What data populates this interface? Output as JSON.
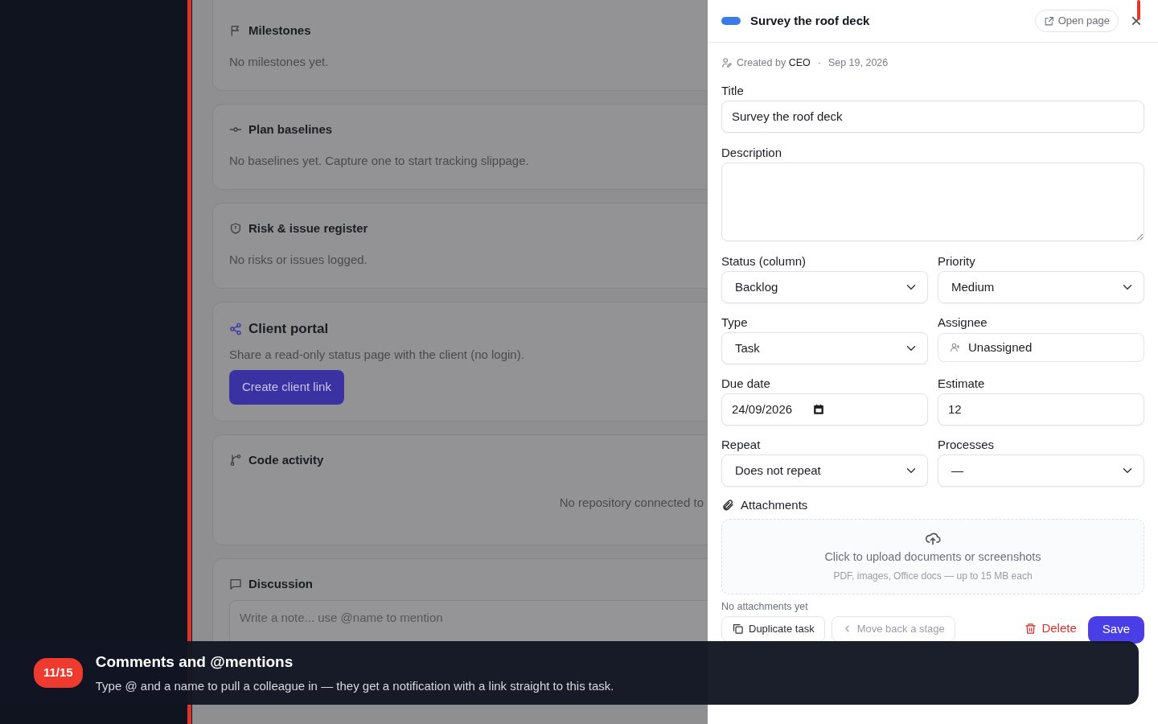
{
  "backdrop": {
    "cards": [
      {
        "kind": "note",
        "title": "Milestones",
        "text": "No milestones yet."
      },
      {
        "kind": "note",
        "title": "Plan baselines",
        "text": "No baselines yet. Capture one to start tracking slippage."
      },
      {
        "kind": "note",
        "title": "Risk & issue register",
        "text": "No risks or issues logged."
      },
      {
        "kind": "action",
        "title": "Client portal",
        "text": "Share a read-only status page with the client (no login).",
        "button": "Create client link"
      },
      {
        "kind": "empty",
        "title": "Code activity",
        "text": "No repository connected to"
      },
      {
        "kind": "comment",
        "title": "Discussion",
        "placeholder": "Write a note... use @name to mention"
      }
    ]
  },
  "panel": {
    "title": "Survey the roof deck",
    "open_page": "Open page",
    "close": "×",
    "meta": {
      "created_by_label": "Created by",
      "creator": "CEO",
      "separator": "·",
      "date": "Sep 19, 2026"
    },
    "title_field": {
      "label": "Title",
      "value": "Survey the roof deck"
    },
    "description_field": {
      "label": "Description"
    },
    "fields": [
      {
        "kind": "select",
        "label": "Status (column)",
        "value": "Backlog"
      },
      {
        "kind": "select",
        "label": "Priority",
        "value": "Medium"
      },
      {
        "kind": "select",
        "label": "Type",
        "value": "Task"
      },
      {
        "kind": "person",
        "label": "Assignee",
        "value": "Unassigned"
      },
      {
        "kind": "date",
        "label": "Due date",
        "value": "24/09/2026"
      },
      {
        "kind": "text",
        "label": "Estimate",
        "value": "12"
      },
      {
        "kind": "select",
        "label": "Repeat",
        "value": "Does not repeat"
      },
      {
        "kind": "select",
        "label": "Processes",
        "value": "—"
      }
    ],
    "attachments": {
      "label": "Attachments",
      "upload_text": "Click to upload documents or screenshots",
      "upload_hint": "PDF, images, Office docs — up to 15 MB each",
      "empty": "No attachments yet"
    },
    "actions": {
      "duplicate": "Duplicate task",
      "move_back": "Move back a stage",
      "delete": "Delete",
      "save": "Save"
    }
  },
  "tour": {
    "step": "11/15",
    "title": "Comments and @mentions",
    "text": "Type @ and a name to pull a colleague in — they get a notification with a link straight to this task."
  }
}
